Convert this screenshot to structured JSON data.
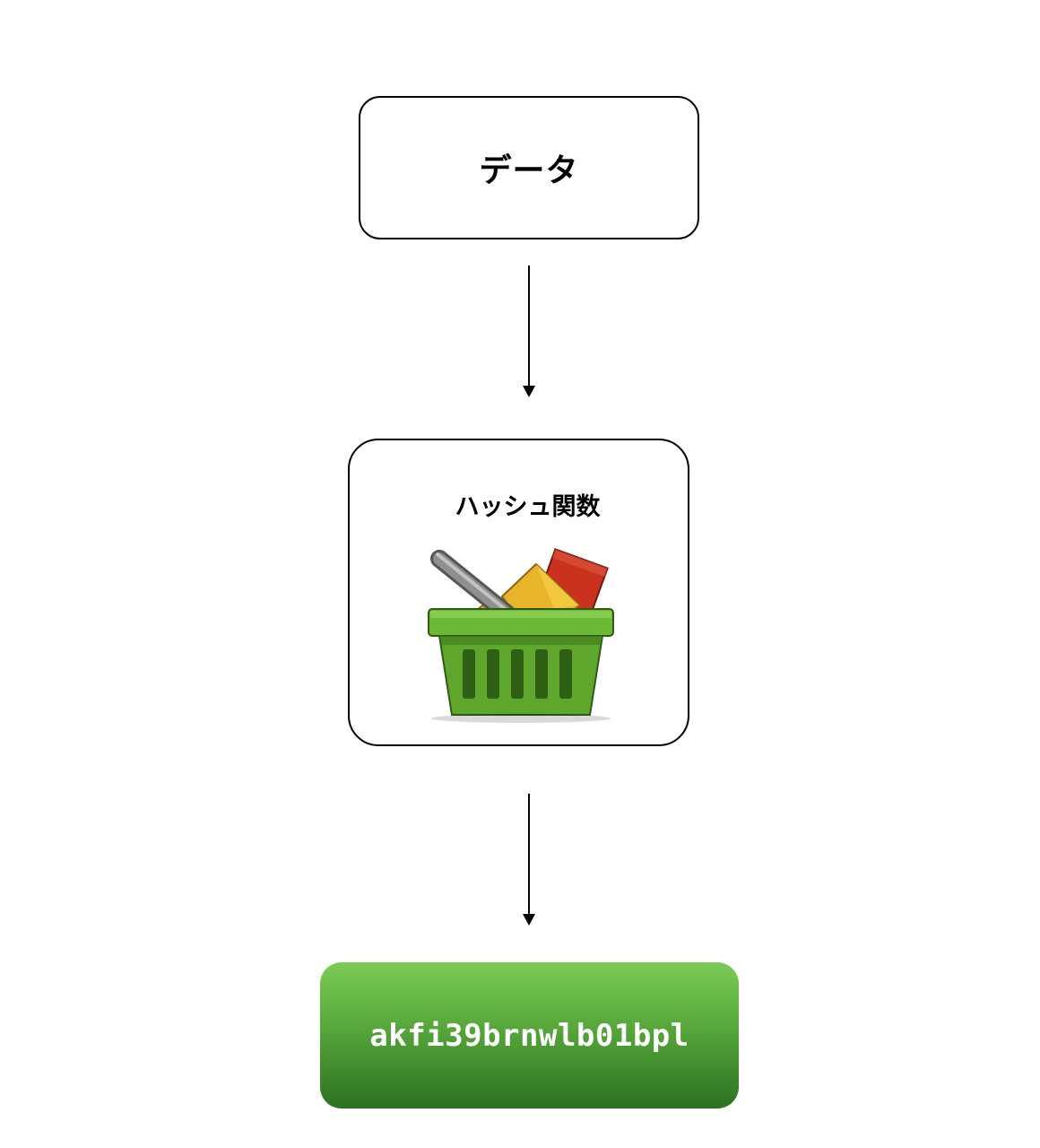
{
  "nodes": {
    "input": {
      "label": "データ"
    },
    "hash_function": {
      "label": "ハッシュ関数",
      "icon": "basket-icon"
    },
    "output": {
      "label": "akfi39brnwlb01bpl",
      "color_top": "#7bcc55",
      "color_bottom": "#2c7220"
    }
  },
  "edges": [
    {
      "from": "input",
      "to": "hash_function"
    },
    {
      "from": "hash_function",
      "to": "output"
    }
  ]
}
